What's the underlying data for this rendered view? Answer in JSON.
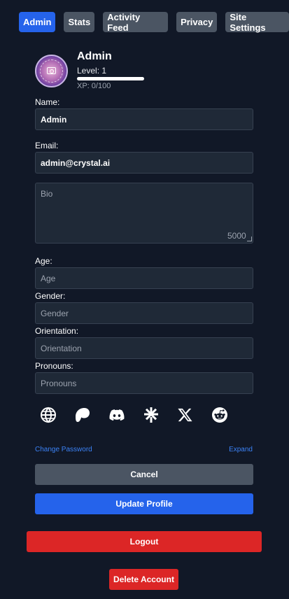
{
  "tabs": [
    {
      "label": "Admin",
      "active": true
    },
    {
      "label": "Stats",
      "active": false
    },
    {
      "label": "Activity Feed",
      "active": false
    },
    {
      "label": "Privacy",
      "active": false
    },
    {
      "label": "Site Settings",
      "active": false
    }
  ],
  "profile": {
    "name": "Admin",
    "level": "Level: 1",
    "xp_text": "XP: 0/100",
    "xp_fraction": 0,
    "avatar_icon": "camera-icon"
  },
  "form": {
    "name_label": "Name:",
    "name_value": "Admin",
    "email_label": "Email:",
    "email_value": "admin@crystal.ai",
    "bio_placeholder": "Bio",
    "bio_remaining": "5000",
    "age_label": "Age:",
    "age_placeholder": "Age",
    "gender_label": "Gender:",
    "gender_placeholder": "Gender",
    "orientation_label": "Orientation:",
    "orientation_placeholder": "Orientation",
    "pronouns_label": "Pronouns:",
    "pronouns_placeholder": "Pronouns"
  },
  "socials": [
    "globe-icon",
    "patreon-icon",
    "discord-icon",
    "linktree-icon",
    "x-icon",
    "reddit-icon"
  ],
  "links": {
    "change_password": "Change Password",
    "expand": "Expand"
  },
  "buttons": {
    "cancel": "Cancel",
    "update": "Update Profile",
    "logout": "Logout",
    "delete": "Delete Account"
  },
  "colors": {
    "background": "#111827",
    "accent": "#2563eb",
    "neutral_button": "#4b5563",
    "danger": "#dc2626",
    "link": "#3b82f6"
  }
}
